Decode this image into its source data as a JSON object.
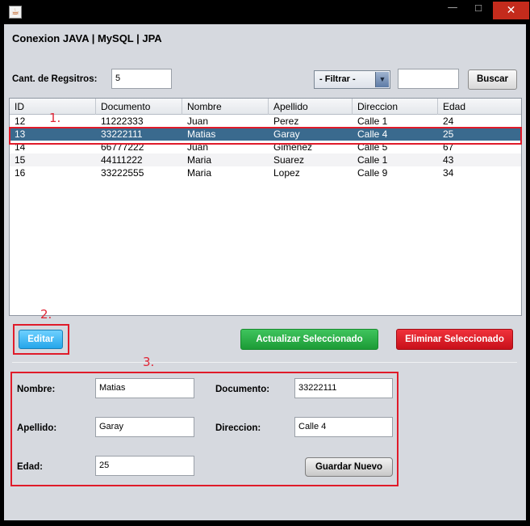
{
  "window": {
    "title": "",
    "controls": {
      "minimize": "—",
      "maximize": "☐",
      "close": "✕"
    },
    "icon": "java-cup-icon"
  },
  "app_title": "Conexion JAVA | MySQL | JPA",
  "toolbar": {
    "count_label": "Cant. de Regsitros:",
    "count_value": "5",
    "filter_selected": "- Filtrar -",
    "filter_value": "",
    "search_label": "Buscar"
  },
  "table": {
    "columns": [
      "ID",
      "Documento",
      "Nombre",
      "Apellido",
      "Direccion",
      "Edad"
    ],
    "rows": [
      [
        "12",
        "11222333",
        "Juan",
        "Perez",
        "Calle 1",
        "24"
      ],
      [
        "13",
        "33222111",
        "Matias",
        "Garay",
        "Calle 4",
        "25"
      ],
      [
        "14",
        "66777222",
        "Juan",
        "Gimenez",
        "Calle 5",
        "67"
      ],
      [
        "15",
        "44111222",
        "Maria",
        "Suarez",
        "Calle 1",
        "43"
      ],
      [
        "16",
        "33222555",
        "Maria",
        "Lopez",
        "Calle 9",
        "34"
      ]
    ],
    "selected_row": 1
  },
  "annotations": {
    "one": "1.",
    "two": "2.",
    "three": "3."
  },
  "actions": {
    "edit_label": "Editar",
    "update_label": "Actualizar Seleccionado",
    "delete_label": "Eliminar Seleccionado"
  },
  "form": {
    "nombre_label": "Nombre:",
    "nombre_value": "Matias",
    "apellido_label": "Apellido:",
    "apellido_value": "Garay",
    "edad_label": "Edad:",
    "edad_value": "25",
    "documento_label": "Documento:",
    "documento_value": "33222111",
    "direccion_label": "Direccion:",
    "direccion_value": "Calle 4",
    "save_label": "Guardar Nuevo"
  },
  "colors": {
    "selection": "#3a6a8e",
    "edit_button": "#24a6ea",
    "update_button": "#1c9b36",
    "delete_button": "#c8101a",
    "highlight": "#e01b2a"
  }
}
